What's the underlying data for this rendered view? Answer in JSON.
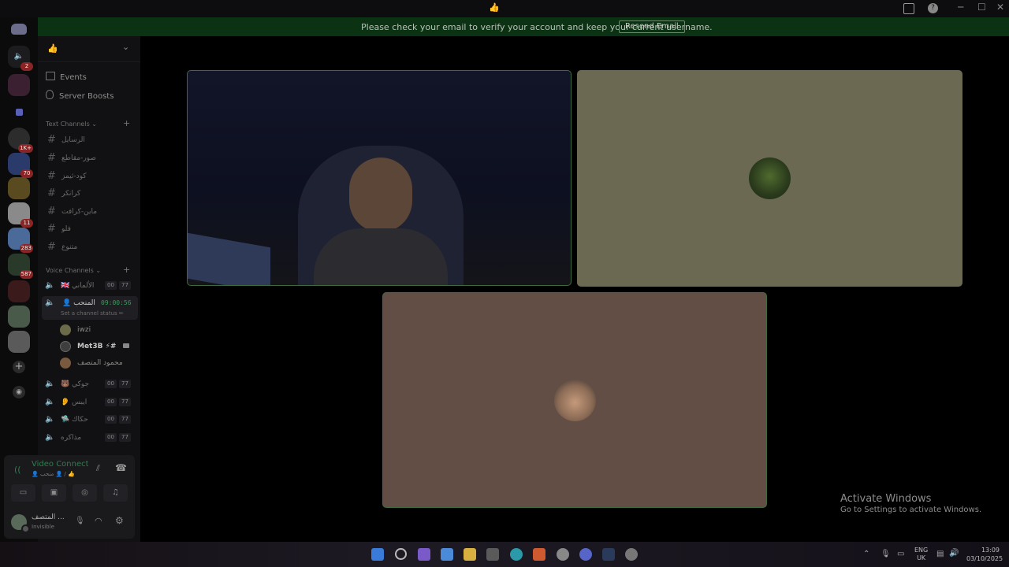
{
  "titlebar": {
    "title_emoji": "👍",
    "min": "─",
    "max": "☐",
    "close": "✕",
    "help": "?"
  },
  "banner": {
    "message": "Please check your email to verify your account and keep your current username.",
    "button": "Resend Email"
  },
  "server": {
    "name": "👍",
    "chevron": "⌄"
  },
  "rail_badges": [
    "2",
    "1K+",
    "70",
    "11",
    "283",
    "587"
  ],
  "nav": {
    "events": "Events",
    "boosts": "Server Boosts"
  },
  "text_header": "Text Channels",
  "text_channels": [
    "الرسايل",
    "صور-مقاطع",
    "كود-ثيمز",
    "كرانكر",
    "ماين-كرافت",
    "فلو",
    "متنوع"
  ],
  "voice_header": "Voice Channels",
  "voice_channels": [
    {
      "name": "🇬🇧 الألماني",
      "a": "00",
      "b": "77"
    },
    {
      "name": "👤 المنحب",
      "timer": "09:00:56"
    },
    {
      "name": "🐻 جوكي",
      "a": "00",
      "b": "77"
    },
    {
      "name": "👂 ايبس",
      "a": "00",
      "b": "77"
    },
    {
      "name": "🛸 حكاك",
      "a": "00",
      "b": "77"
    },
    {
      "name": "مذاكره",
      "a": "00",
      "b": "77"
    }
  ],
  "channel_status": "Set a channel status ✏",
  "members": [
    {
      "name": "iwzi",
      "color": "#6b6b4a"
    },
    {
      "name": "Met3B ⚡#",
      "color": "#3e3e3e"
    },
    {
      "name": "محمود المتصف",
      "color": "#7a5a3e"
    }
  ],
  "voice_panel": {
    "status": "Video Connected",
    "channel": "👤 منحب 👤 / 👍"
  },
  "user_panel": {
    "name": "المتصف ...",
    "status": "Invisible"
  },
  "watermark": {
    "line1": "Activate Windows",
    "line2": "Go to Settings to activate Windows."
  },
  "tray": {
    "lang1": "ENG",
    "lang2": "UK",
    "time": "13:09",
    "date": "03/10/2025"
  },
  "colors": {
    "accent_green": "#3d6b3d",
    "banner": "#0b3212",
    "voice_green": "#2e7d4f"
  }
}
